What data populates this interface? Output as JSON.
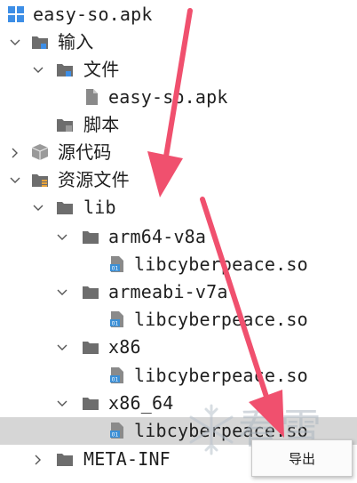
{
  "tree": {
    "root": {
      "label": "easy-so.apk",
      "icon": "apk-grid-icon"
    },
    "input": {
      "label": "输入",
      "icon": "input-folder-icon"
    },
    "files": {
      "label": "文件",
      "icon": "files-folder-icon"
    },
    "apk_file": {
      "label": "easy-so.apk",
      "icon": "file-icon"
    },
    "scripts": {
      "label": "脚本",
      "icon": "script-folder-icon"
    },
    "source": {
      "label": "源代码",
      "icon": "package-icon"
    },
    "resources": {
      "label": "资源文件",
      "icon": "resources-folder-icon"
    },
    "lib": {
      "label": "lib",
      "icon": "folder-icon"
    },
    "arm64": {
      "label": "arm64-v8a",
      "icon": "folder-icon"
    },
    "arm64_so": {
      "label": "libcyberpeace.so",
      "icon": "binary-file-icon"
    },
    "armeabi": {
      "label": "armeabi-v7a",
      "icon": "folder-icon"
    },
    "armeabi_so": {
      "label": "libcyberpeace.so",
      "icon": "binary-file-icon"
    },
    "x86": {
      "label": "x86",
      "icon": "folder-icon"
    },
    "x86_so": {
      "label": "libcyberpeace.so",
      "icon": "binary-file-icon"
    },
    "x86_64": {
      "label": "x86_64",
      "icon": "folder-icon"
    },
    "x86_64_so": {
      "label": "libcyberpeace.so",
      "icon": "binary-file-icon"
    },
    "meta_inf": {
      "label": "META-INF",
      "icon": "folder-icon"
    }
  },
  "context_menu": {
    "export_label": "导出"
  },
  "watermark": {
    "text": "看雪",
    "icon": "snowflake-icon"
  },
  "colors": {
    "selection": "#d6d6d6",
    "folder": "#6d6d6d",
    "annotation_arrow": "#f0506e",
    "file_badge": "#3b8fd6"
  }
}
